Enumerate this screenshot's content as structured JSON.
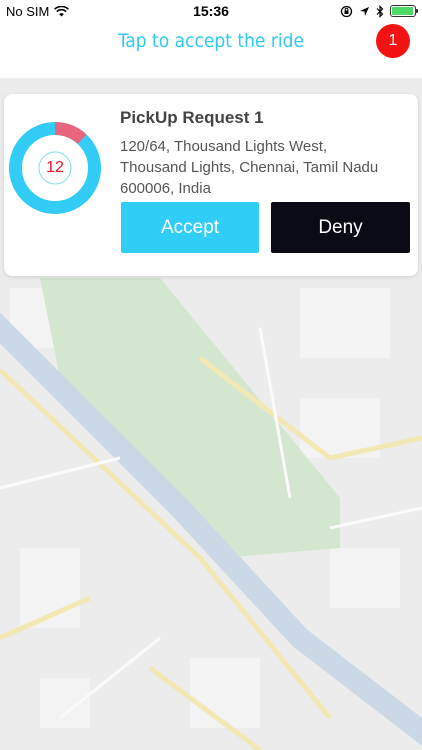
{
  "status_bar": {
    "carrier": "No SIM",
    "time": "15:36",
    "battery_level": 0.95,
    "icons": [
      "wifi-icon",
      "rotation-lock-icon",
      "location-arrow-icon",
      "bluetooth-icon",
      "battery-icon"
    ]
  },
  "header": {
    "title": "Tap to accept the ride",
    "badge_count": "1"
  },
  "request": {
    "title": "PickUp Request 1",
    "address_lines": [
      "120/64, Thousand Lights West,",
      "Thousand Lights, Chennai, Tamil Nadu",
      "600006, India"
    ],
    "timer_value": "12",
    "timer_remaining_fraction": 0.88,
    "accept_label": "Accept",
    "deny_label": "Deny"
  },
  "colors": {
    "accent": "#2ec9f5",
    "accept": "#30cdf7",
    "deny": "#0b0b16",
    "timer_ring": "#33ccf6",
    "timer_elapsed": "#e9657d",
    "badge": "#f41313"
  }
}
